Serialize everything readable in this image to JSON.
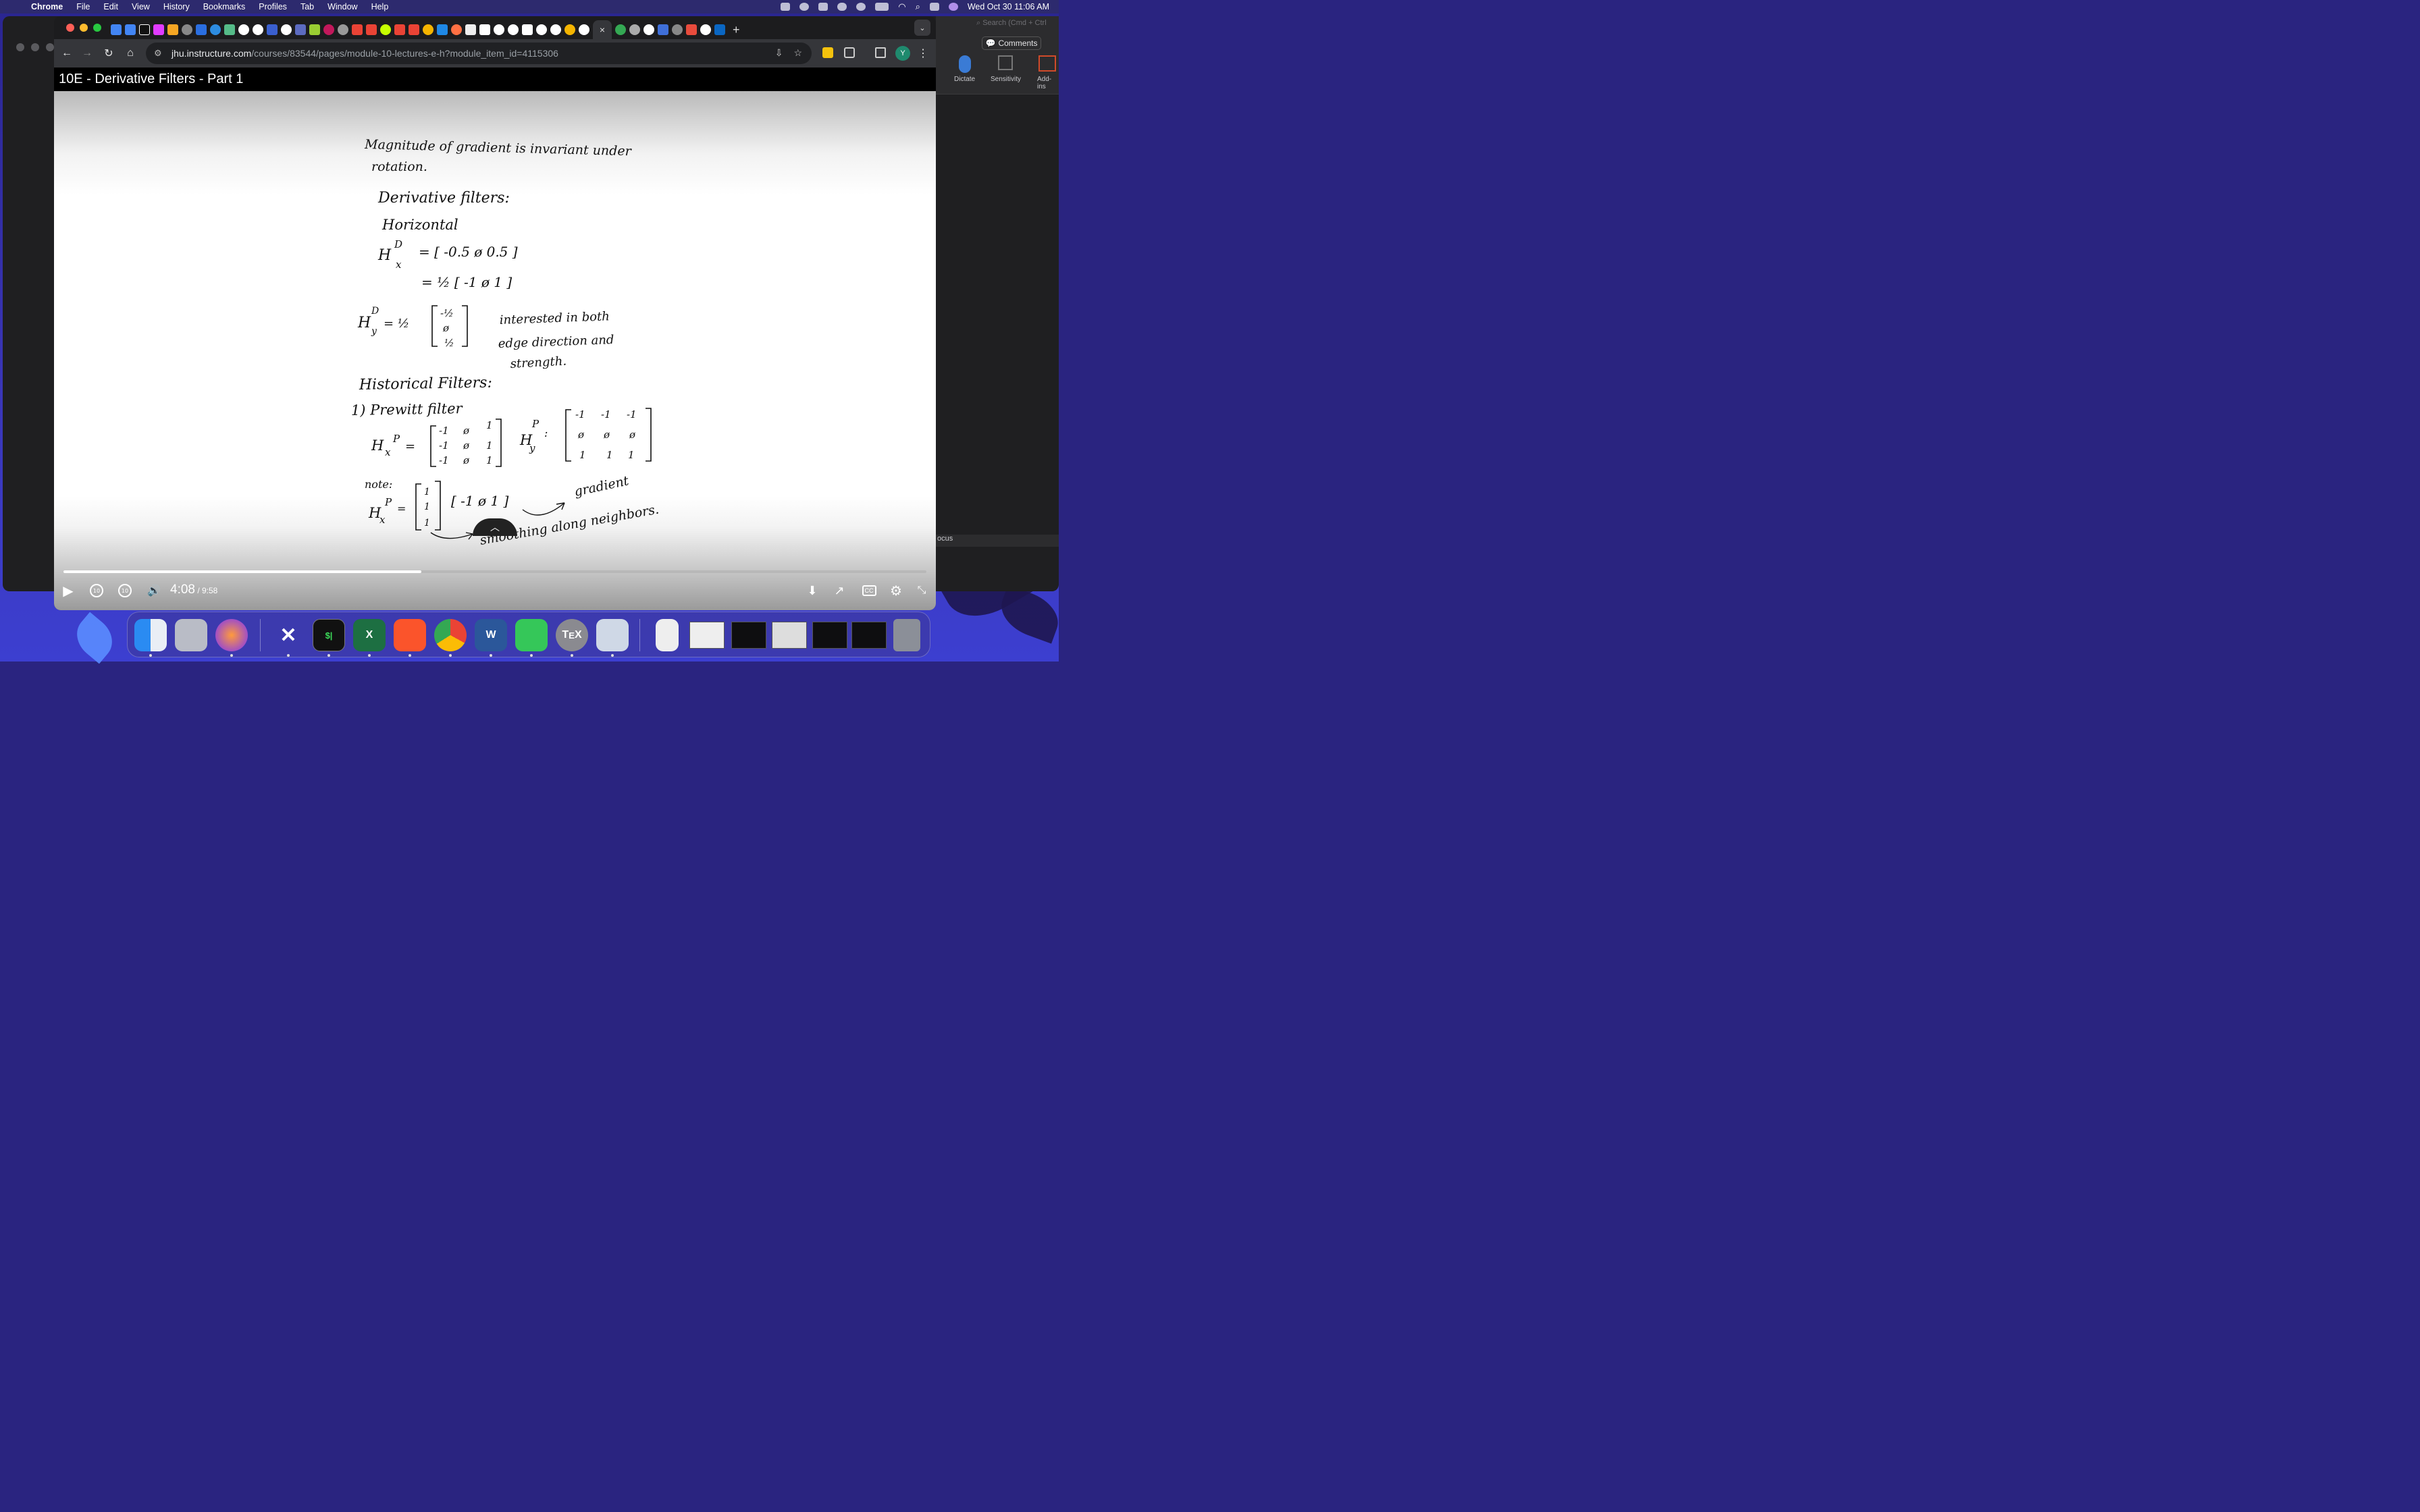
{
  "menubar": {
    "app": "Chrome",
    "menus": [
      "File",
      "Edit",
      "View",
      "History",
      "Bookmarks",
      "Profiles",
      "Tab",
      "Window",
      "Help"
    ],
    "datetime": "Wed Oct 30  11:06 AM"
  },
  "background_app": {
    "search_placeholder": "Search (Cmd + Ctrl",
    "comments_label": "Comments",
    "ribbon": [
      "Dictate",
      "Sensitivity",
      "Add-ins"
    ],
    "status_focus": "ocus"
  },
  "browser": {
    "url_host": "jhu.instructure.com",
    "url_path": "/courses/83544/pages/module-10-lectures-e-h?module_item_id=4115306",
    "profile_initial": "Y",
    "active_tab_close": "×",
    "new_tab": "+"
  },
  "video": {
    "title": "10E - Derivative Filters - Part 1",
    "current_time": "4:08",
    "total_time": " / 9:58",
    "progress": 0.415,
    "skip_back_seconds": "10",
    "skip_forward_seconds": "10"
  },
  "notes": {
    "line1": "Magnitude of gradient is invariant under",
    "line2": "rotation.",
    "heading": "Derivative filters:",
    "horizontal": "Horizontal",
    "hx_label": "H",
    "hx_sup": "D",
    "hx_sub": "x",
    "row1": "=  [ -0.5     ø      0.5 ]",
    "row2": "=  ½ [ -1     ø      1 ]",
    "hy_label": "H",
    "hy_sup": "D",
    "hy_sub": "y",
    "hy_eq": "=  ½",
    "hy_col": [
      "-½",
      "ø",
      "½"
    ],
    "side1": "interested in both",
    "side2": "edge direction and",
    "side3": "strength.",
    "historical": "Historical Filters:",
    "prewitt": "1) Prewitt filter",
    "hxp_label": "H",
    "hxp_sub": "x",
    "hxp_sup": "P",
    "hxp_matrix": [
      [
        "-1",
        "ø",
        "1"
      ],
      [
        "-1",
        "ø",
        "1"
      ],
      [
        "-1",
        "ø",
        "1"
      ]
    ],
    "hyp_label": "H",
    "hyp_sub": "y",
    "hyp_sup": "P",
    "hyp_matrix": [
      [
        "-1",
        "-1",
        "-1"
      ],
      [
        "ø",
        "ø",
        "ø"
      ],
      [
        "1",
        "1",
        "1"
      ]
    ],
    "note": "note:",
    "note_col": [
      "1",
      "1",
      "1"
    ],
    "note_row": "[ -1    ø    1 ]",
    "gradient": "gradient",
    "smoothing": "smoothing along neighbors."
  }
}
